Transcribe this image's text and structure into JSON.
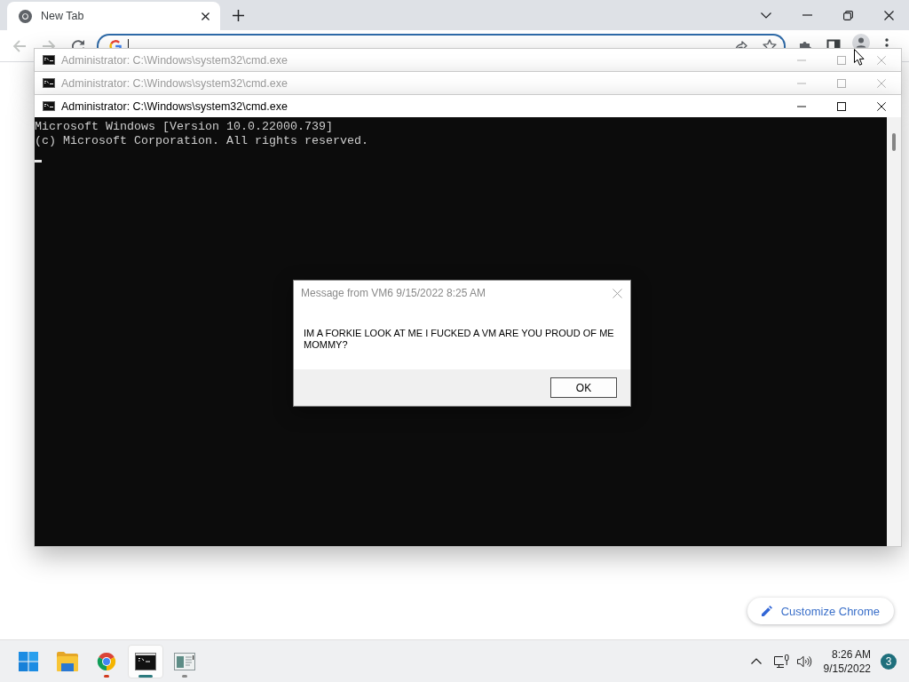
{
  "browser": {
    "tabs": [
      {
        "title": "New Tab",
        "selected": true
      }
    ],
    "nav_buttons": [
      {
        "kind": "back",
        "disabled": true
      },
      {
        "kind": "forward",
        "disabled": true
      },
      {
        "kind": "reload",
        "disabled": false
      }
    ],
    "address_bar": {
      "focused": true
    },
    "customize_button": {
      "label": "Customize Chrome"
    }
  },
  "cmd_windows": [
    {
      "title": "Administrator: C:\\Windows\\system32\\cmd.exe",
      "active": false
    },
    {
      "title": "Administrator: C:\\Windows\\system32\\cmd.exe",
      "active": false
    },
    {
      "title": "Administrator: C:\\Windows\\system32\\cmd.exe",
      "active": true,
      "lines": [
        "Microsoft Windows [Version 10.0.22000.739]",
        "(c) Microsoft Corporation. All rights reserved."
      ]
    }
  ],
  "message_box": {
    "title": "Message from VM6 9/15/2022 8:25 AM",
    "message": "IM A FORKIE LOOK AT ME I FUCKED A VM ARE YOU PROUD OF ME MOMMY?",
    "button": "OK"
  },
  "taskbar": {
    "apps": [
      {
        "kind": "start",
        "running": false,
        "selected": false,
        "attention": false
      },
      {
        "kind": "folder",
        "running": false,
        "selected": false,
        "attention": false
      },
      {
        "kind": "browser",
        "running": true,
        "selected": false,
        "attention": true
      },
      {
        "kind": "terminal",
        "running": true,
        "selected": true,
        "attention": false
      },
      {
        "kind": "window",
        "running": true,
        "selected": false,
        "attention": false
      }
    ],
    "clock": {
      "time": "8:26 AM",
      "date": "9/15/2022"
    },
    "notifications": "3"
  }
}
